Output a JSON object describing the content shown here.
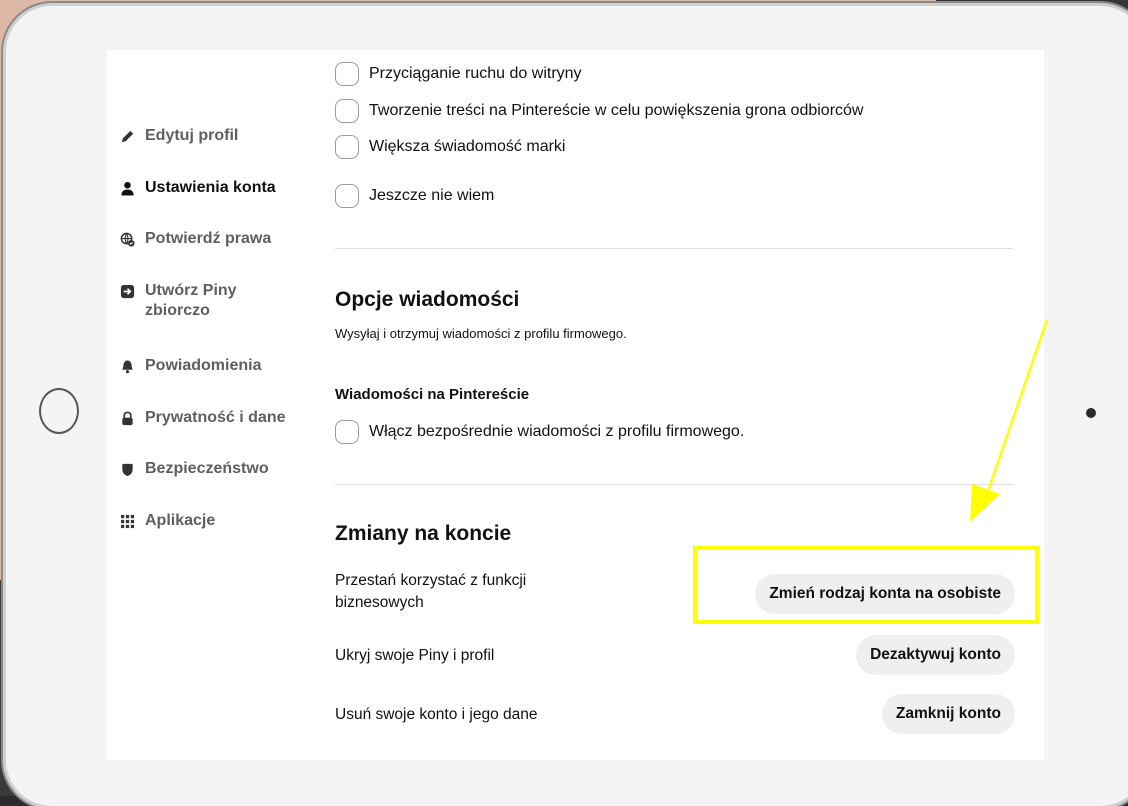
{
  "sidebar": {
    "items": [
      {
        "label": "Edytuj profil",
        "icon": "pencil-icon"
      },
      {
        "label": "Ustawienia konta",
        "icon": "person-icon",
        "active": true
      },
      {
        "label": "Potwierdź prawa",
        "icon": "globe-check-icon"
      },
      {
        "label": "Utwórz Piny zbiorczo",
        "icon": "import-icon"
      },
      {
        "label": "Powiadomienia",
        "icon": "bell-icon"
      },
      {
        "label": "Prywatność i dane",
        "icon": "lock-icon"
      },
      {
        "label": "Bezpieczeństwo",
        "icon": "shield-icon"
      },
      {
        "label": "Aplikacje",
        "icon": "apps-grid-icon"
      }
    ]
  },
  "goals": {
    "options": [
      "Przyciąganie ruchu do witryny",
      "Tworzenie treści na Pintereście w celu powiększenia grona odbiorców",
      "Większa świadomość marki",
      "Jeszcze nie wiem"
    ]
  },
  "messages": {
    "title": "Opcje wiadomości",
    "description": "Wysyłaj i otrzymuj wiadomości z profilu firmowego.",
    "subtitle": "Wiadomości na Pintereście",
    "toggle_label": "Włącz bezpośrednie wiadomości z profilu firmowego."
  },
  "account_changes": {
    "title": "Zmiany na koncie",
    "rows": [
      {
        "text": "Przestań korzystać z funkcji biznesowych",
        "button": "Zmień rodzaj konta na osobiste"
      },
      {
        "text": "Ukryj swoje Piny i profil",
        "button": "Dezaktywuj konto"
      },
      {
        "text": "Usuń swoje konto i jego dane",
        "button": "Zamknij konto"
      }
    ]
  },
  "colors": {
    "highlight": "#ffff00",
    "pill_bg": "#efefef"
  }
}
